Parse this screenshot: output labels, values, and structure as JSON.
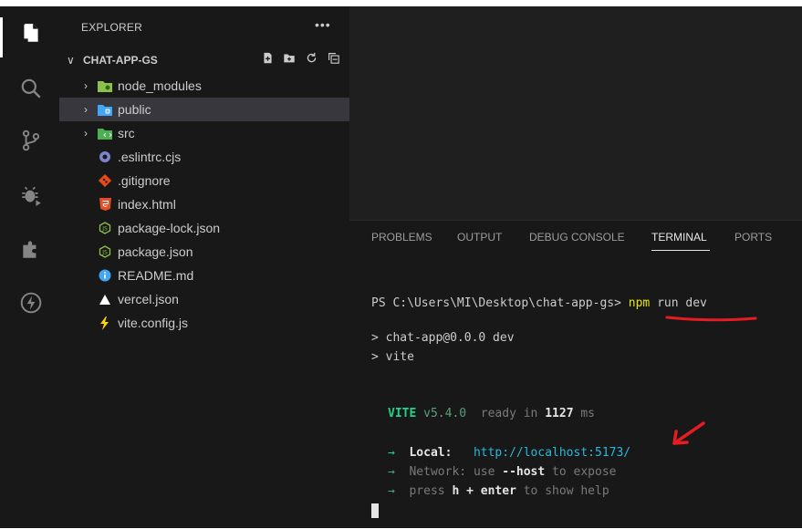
{
  "sidebar": {
    "header": "EXPLORER",
    "more": "•••",
    "project": "CHAT-APP-GS",
    "items": [
      {
        "label": "node_modules",
        "type": "folder",
        "icon": "node-folder-icon",
        "color": "#8bc34a"
      },
      {
        "label": "public",
        "type": "folder",
        "icon": "public-folder-icon",
        "color": "#42a5f5"
      },
      {
        "label": "src",
        "type": "folder",
        "icon": "src-folder-icon",
        "color": "#4caf50"
      },
      {
        "label": ".eslintrc.cjs",
        "type": "file",
        "icon": "eslint-icon",
        "color": "#7986cb"
      },
      {
        "label": ".gitignore",
        "type": "file",
        "icon": "git-icon",
        "color": "#e64a19"
      },
      {
        "label": "index.html",
        "type": "file",
        "icon": "html-icon",
        "color": "#e44d26"
      },
      {
        "label": "package-lock.json",
        "type": "file",
        "icon": "npm-icon",
        "color": "#8bc34a"
      },
      {
        "label": "package.json",
        "type": "file",
        "icon": "npm-icon",
        "color": "#8bc34a"
      },
      {
        "label": "README.md",
        "type": "file",
        "icon": "info-icon",
        "color": "#42a5f5"
      },
      {
        "label": "vercel.json",
        "type": "file",
        "icon": "vercel-icon",
        "color": "#ffffff"
      },
      {
        "label": "vite.config.js",
        "type": "file",
        "icon": "vite-icon",
        "color": "#ffd600"
      }
    ]
  },
  "panel": {
    "tabs": [
      "PROBLEMS",
      "OUTPUT",
      "DEBUG CONSOLE",
      "TERMINAL",
      "PORTS"
    ],
    "active_tab": "TERMINAL"
  },
  "terminal": {
    "prompt": "PS C:\\Users\\MI\\Desktop\\chat-app-gs>",
    "cmd_npm": "npm",
    "cmd_rest": "run dev",
    "out1": "> chat-app@0.0.0 dev",
    "out2": "> vite",
    "vite_name": "VITE",
    "vite_version": "v5.4.0",
    "ready_text": "ready in",
    "ready_ms": "1127",
    "ms": "ms",
    "arrow": "→",
    "local_label": "Local:",
    "local_url": "http://localhost:5173/",
    "network_label": "Network:",
    "network_text1": "use",
    "network_flag": "--host",
    "network_text2": "to expose",
    "help_text1": "press",
    "help_key": "h + enter",
    "help_text2": "to show help"
  },
  "colors": {
    "annotation_red": "#e51c23"
  }
}
